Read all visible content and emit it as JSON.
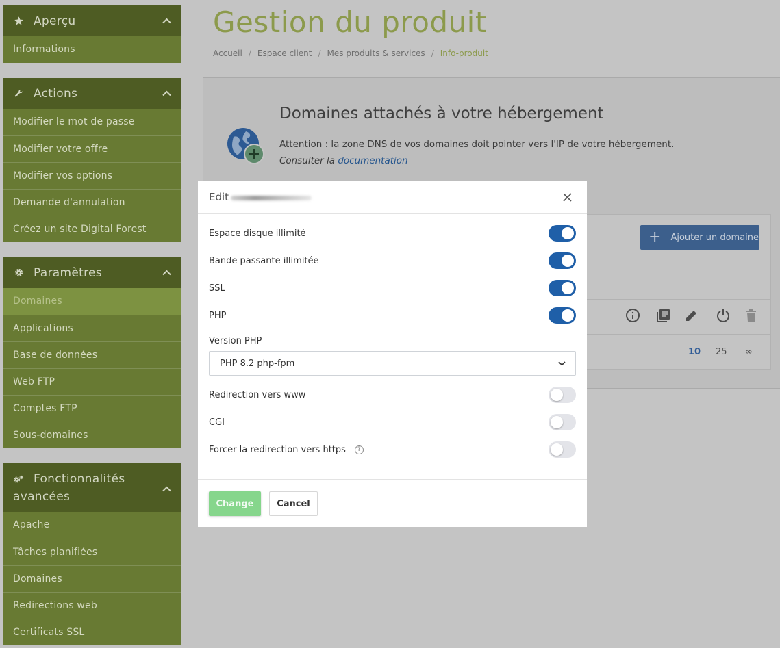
{
  "sidebar": {
    "panels": [
      {
        "title": "Aperçu",
        "icon": "star-icon",
        "items": [
          "Informations"
        ]
      },
      {
        "title": "Actions",
        "icon": "wrench-icon",
        "items": [
          "Modifier le mot de passe",
          "Modifier votre offre",
          "Modifier vos options",
          "Demande d'annulation",
          "Créez un site Digital Forest"
        ]
      },
      {
        "title": "Paramètres",
        "icon": "gear-icon",
        "items": [
          "Domaines",
          "Applications",
          "Base de données",
          "Web FTP",
          "Comptes FTP",
          "Sous-domaines"
        ],
        "active": "Domaines"
      },
      {
        "title_line1": "Fonctionnalités",
        "title_line2": "avancées",
        "icon": "gears-icon",
        "items": [
          "Apache",
          "Tâches planifiées",
          "Domaines",
          "Redirections web",
          "Certificats SSL"
        ]
      }
    ]
  },
  "header": {
    "title": "Gestion du produit",
    "breadcrumb": [
      "Accueil",
      "Espace client",
      "Mes produits & services",
      "Info-produit"
    ]
  },
  "card": {
    "title": "Domaines attachés à votre hébergement",
    "notice": "Attention : la zone DNS de vos domaines doit pointer vers l'IP de votre hébergement.",
    "consult_prefix": "Consulter la ",
    "consult_link": "documentation",
    "add_button": "Ajouter un domaine",
    "page_sizes": [
      "10",
      "25",
      "∞"
    ]
  },
  "modal": {
    "title": "Edit",
    "options": [
      {
        "label": "Espace disque illimité",
        "enabled": true
      },
      {
        "label": "Bande passante illimitée",
        "enabled": true
      },
      {
        "label": "SSL",
        "enabled": true
      },
      {
        "label": "PHP",
        "enabled": true
      }
    ],
    "php_version_label": "Version PHP",
    "php_version_value": "PHP 8.2 php-fpm",
    "options2": [
      {
        "label": "Redirection vers www",
        "enabled": false
      },
      {
        "label": "CGI",
        "enabled": false
      },
      {
        "label": "Forcer la redirection vers https",
        "enabled": false,
        "help": "?"
      }
    ],
    "change_button": "Change",
    "cancel_button": "Cancel"
  },
  "colors": {
    "sidebar_header": "#4e5c23",
    "sidebar_item": "#687a33",
    "accent_olive": "#8c9a4c",
    "toggle_on": "#1f5fa8",
    "change_button": "#86d68c"
  }
}
